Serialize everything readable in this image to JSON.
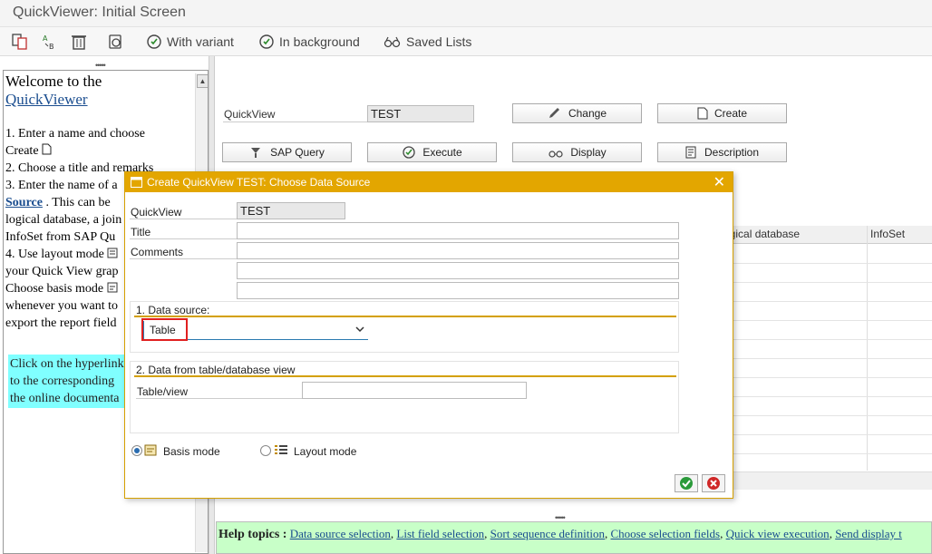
{
  "window": {
    "title": "QuickViewer: Initial Screen"
  },
  "toolbar": {
    "with_variant": "With variant",
    "in_background": "In background",
    "saved_lists": "Saved Lists"
  },
  "left_pane": {
    "welcome": "Welcome to the",
    "welcome_link": "QuickViewer",
    "lines": [
      "1. Enter a name and choose",
      "Create",
      "2. Choose a title and remarks",
      "3. Enter the name of a",
      "Source",
      ". This can be",
      "logical database, a join",
      "InfoSet from SAP Qu",
      "4. Use layout mode",
      "your Quick View grap",
      "Choose basis mode",
      "whenever you want to",
      "export the report field"
    ],
    "hint": [
      "Click on the hyperlink",
      "to the corresponding",
      "the online documenta"
    ]
  },
  "main": {
    "quickview_label": "QuickView",
    "quickview_value": "TEST",
    "buttons": {
      "change": "Change",
      "create": "Create",
      "sap_query": "SAP Query",
      "execute": "Execute",
      "display": "Display",
      "description": "Description"
    },
    "table": {
      "col_logical_db": "ogical database",
      "col_infoset": "InfoSet"
    }
  },
  "dialog": {
    "title": "Create QuickView TEST: Choose Data Source",
    "quickview_label": "QuickView",
    "quickview_value": "TEST",
    "title_label": "Title",
    "comments_label": "Comments",
    "group1_title": "1. Data source:",
    "data_source_value": "Table",
    "group2_title": "2. Data from table/database view",
    "tableview_label": "Table/view",
    "basis_mode": "Basis mode",
    "layout_mode": "Layout mode"
  },
  "help": {
    "label": "Help topics :",
    "links": [
      "Data source selection",
      "List field selection",
      "Sort sequence definition",
      "Choose selection fields",
      "Quick view execution",
      "Send display t"
    ]
  },
  "colors": {
    "dialog_title": "#e3a600",
    "help_bg": "#c8ffc8",
    "hint_bg": "#80ffff",
    "highlight": "#e02020"
  }
}
